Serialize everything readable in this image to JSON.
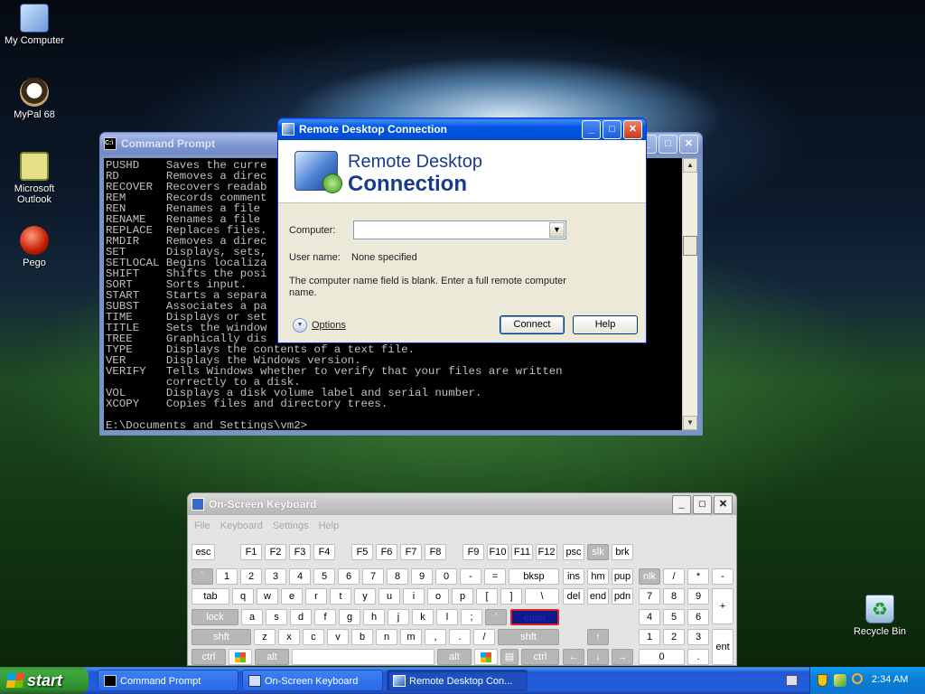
{
  "desktop": {
    "icons": [
      {
        "label": "My Computer"
      },
      {
        "label": "MyPal 68"
      },
      {
        "label": "Microsoft Outlook"
      },
      {
        "label": "Pego"
      },
      {
        "label": "Recycle Bin"
      }
    ]
  },
  "cmd": {
    "title": "Command Prompt",
    "lines": [
      "PUSHD    Saves the curre",
      "RD       Removes a direc",
      "RECOVER  Recovers readab",
      "REM      Records comment",
      "REN      Renames a file",
      "RENAME   Renames a file",
      "REPLACE  Replaces files.",
      "RMDIR    Removes a direc",
      "SET      Displays, sets,",
      "SETLOCAL Begins localiza",
      "SHIFT    Shifts the posi",
      "SORT     Sorts input.",
      "START    Starts a separa",
      "SUBST    Associates a pa",
      "TIME     Displays or set",
      "TITLE    Sets the window",
      "TREE     Graphically dis",
      "TYPE     Displays the contents of a text file.",
      "VER      Displays the Windows version.",
      "VERIFY   Tells Windows whether to verify that your files are written",
      "         correctly to a disk.",
      "VOL      Displays a disk volume label and serial number.",
      "XCOPY    Copies files and directory trees.",
      "",
      "E:\\Documents and Settings\\vm2>"
    ]
  },
  "rdp": {
    "title": "Remote Desktop Connection",
    "banner_line1": "Remote Desktop",
    "banner_line2": "Connection",
    "computer_label": "Computer:",
    "computer_value": "",
    "username_label": "User name:",
    "username_value": "None specified",
    "message": "The computer name field is blank. Enter a full remote computer name.",
    "options_label": "Options",
    "connect_label": "Connect",
    "help_label": "Help"
  },
  "osk": {
    "title": "On-Screen Keyboard",
    "menu": [
      "File",
      "Keyboard",
      "Settings",
      "Help"
    ],
    "highlighted_key": "enter"
  },
  "taskbar": {
    "start_label": "start",
    "tasks": [
      {
        "label": "Command Prompt",
        "active": false
      },
      {
        "label": "On-Screen Keyboard",
        "active": false
      },
      {
        "label": "Remote Desktop Con...",
        "active": true
      }
    ],
    "clock": "2:34 AM"
  },
  "colors": {
    "titlebar_active": "#0055e5",
    "titlebar_inactive": "#7b95cf",
    "taskbar": "#245edb",
    "start_button": "#3fa83f",
    "highlight_key_border": "#e02020"
  }
}
